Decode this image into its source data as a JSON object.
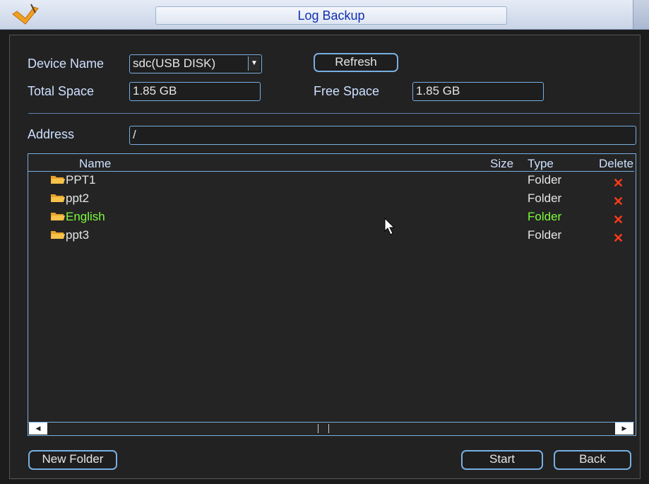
{
  "window": {
    "title": "Log Backup"
  },
  "device": {
    "name_label": "Device Name",
    "name_value": "sdc(USB DISK)",
    "refresh_label": "Refresh",
    "total_label": "Total Space",
    "total_value": "1.85 GB",
    "free_label": "Free Space",
    "free_value": "1.85 GB"
  },
  "address": {
    "label": "Address",
    "value": "/"
  },
  "list": {
    "columns": {
      "name": "Name",
      "size": "Size",
      "type": "Type",
      "delete": "Delete"
    },
    "rows": [
      {
        "name": "PPT1",
        "type": "Folder",
        "selected": false
      },
      {
        "name": "ppt2",
        "type": "Folder",
        "selected": false
      },
      {
        "name": "English",
        "type": "Folder",
        "selected": true
      },
      {
        "name": "ppt3",
        "type": "Folder",
        "selected": false
      }
    ]
  },
  "buttons": {
    "new_folder": "New Folder",
    "start": "Start",
    "back": "Back"
  },
  "colors": {
    "accent_border": "#78aee0",
    "selected_text": "#7cfc3c",
    "delete_icon": "#ff3b1a",
    "title_text": "#1030b0"
  },
  "icons": [
    "app-logo-icon",
    "folder-icon",
    "delete-x-icon",
    "dropdown-arrow-icon",
    "scroll-left-icon",
    "scroll-right-icon",
    "mouse-pointer-icon"
  ]
}
